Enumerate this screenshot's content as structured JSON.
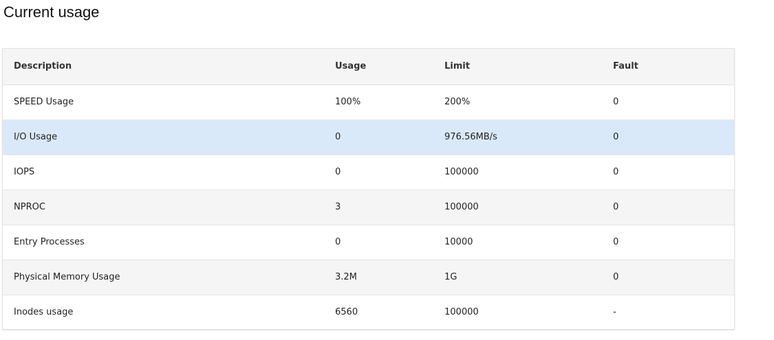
{
  "page": {
    "title": "Current usage"
  },
  "table": {
    "headers": {
      "description": "Description",
      "usage": "Usage",
      "limit": "Limit",
      "fault": "Fault"
    },
    "rows": [
      {
        "description": "SPEED Usage",
        "usage": "100%",
        "limit": "200%",
        "fault": "0"
      },
      {
        "description": "I/O Usage",
        "usage": "0",
        "limit": "976.56MB/s",
        "fault": "0"
      },
      {
        "description": "IOPS",
        "usage": "0",
        "limit": "100000",
        "fault": "0"
      },
      {
        "description": "NPROC",
        "usage": "3",
        "limit": "100000",
        "fault": "0"
      },
      {
        "description": "Entry Processes",
        "usage": "0",
        "limit": "10000",
        "fault": "0"
      },
      {
        "description": "Physical Memory Usage",
        "usage": "3.2M",
        "limit": "1G",
        "fault": "0"
      },
      {
        "description": "Inodes usage",
        "usage": "6560",
        "limit": "100000",
        "fault": "-"
      }
    ],
    "highlighted_row_color": "#d9e9fa"
  }
}
